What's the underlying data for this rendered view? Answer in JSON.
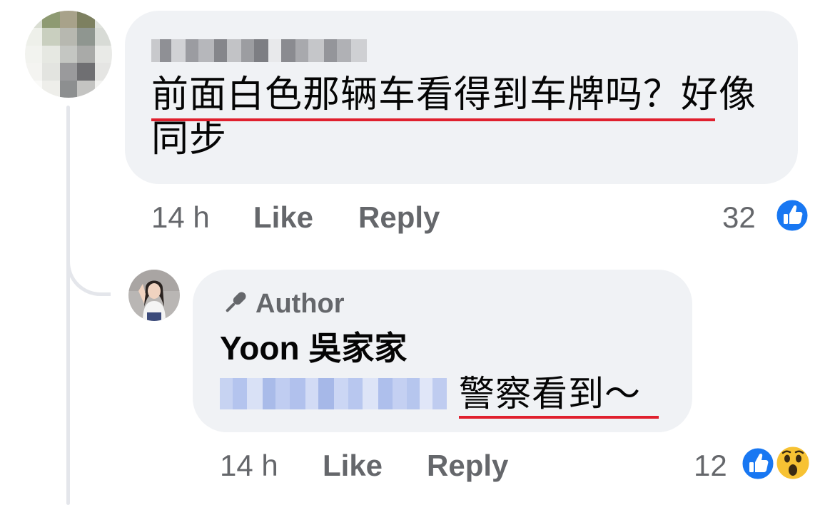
{
  "comment": {
    "avatar_icon": "avatar-pixelated",
    "author_name_blurred": "redacted-name",
    "text": "前面白色那辆车看得到车牌吗？好像同步",
    "time": "14 h",
    "like_label": "Like",
    "reply_label": "Reply",
    "reaction_count": "32",
    "reactions": [
      "like-icon"
    ]
  },
  "reply": {
    "avatar_icon": "avatar-photo",
    "badge_icon": "microphone-icon",
    "badge_label": "Author",
    "author_name": "Yoon 吳家家",
    "mention_blurred": "redacted-mention",
    "text": "警察看到～",
    "time": "14 h",
    "like_label": "Like",
    "reply_label": "Reply",
    "reaction_count": "12",
    "reactions": [
      "like-icon",
      "wow-icon"
    ]
  },
  "colors": {
    "bubble": "#f0f2f5",
    "meta_text": "#65676b",
    "underline": "#e0202e",
    "like_blue": "#1877f2",
    "thread_line": "#e4e6eb"
  }
}
